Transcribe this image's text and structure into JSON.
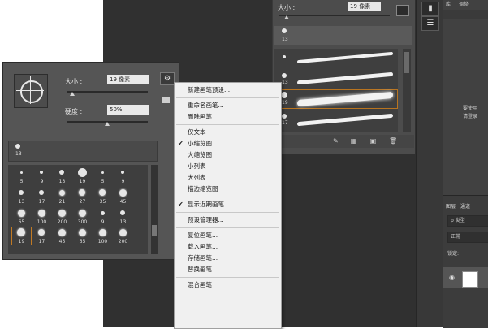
{
  "brush_panel": {
    "size_label": "大小 :",
    "size_value": "19 像素",
    "preset_number": "13",
    "rows": [
      {
        "num": ""
      },
      {
        "num": "13"
      },
      {
        "num": "19"
      },
      {
        "num": "17"
      }
    ]
  },
  "picker": {
    "size_label": "大小 :",
    "size_value": "19 像素",
    "hardness_label": "硬度 :",
    "hardness_value": "50%",
    "recent_number": "13",
    "grid": [
      [
        "5",
        "9",
        "13",
        "19",
        "5",
        "9"
      ],
      [
        "13",
        "17",
        "21",
        "27",
        "35",
        "45"
      ],
      [
        "65",
        "100",
        "200",
        "300",
        "9",
        "13"
      ],
      [
        "19",
        "17",
        "45",
        "65",
        "100",
        "200"
      ]
    ]
  },
  "menu": {
    "items": [
      {
        "label": "新建画笔预设...",
        "checked": false
      },
      {
        "sep": true
      },
      {
        "label": "重命名画笔...",
        "checked": false
      },
      {
        "label": "删除画笔",
        "checked": false
      },
      {
        "sep": true
      },
      {
        "label": "仅文本",
        "checked": false
      },
      {
        "label": "小缩览图",
        "checked": true
      },
      {
        "label": "大缩览图",
        "checked": false
      },
      {
        "label": "小列表",
        "checked": false
      },
      {
        "label": "大列表",
        "checked": false
      },
      {
        "label": "描边缩览图",
        "checked": false
      },
      {
        "sep": true
      },
      {
        "label": "显示近期画笔",
        "checked": true
      },
      {
        "sep": true
      },
      {
        "label": "预设管理器...",
        "checked": false
      },
      {
        "sep": true
      },
      {
        "label": "复位画笔...",
        "checked": false
      },
      {
        "label": "载入画笔...",
        "checked": false
      },
      {
        "label": "存储画笔...",
        "checked": false
      },
      {
        "label": "替换画笔...",
        "checked": false
      },
      {
        "sep": true
      },
      {
        "label": "混合画笔",
        "checked": false
      }
    ]
  },
  "right_panel": {
    "tab1": "库",
    "tab2": "调整",
    "note1": "要使用",
    "note2": "请登录"
  },
  "layers": {
    "tab1": "图层",
    "tab2": "通道",
    "filter": "ρ 类型",
    "blend": "正常",
    "lock": "锁定:"
  }
}
